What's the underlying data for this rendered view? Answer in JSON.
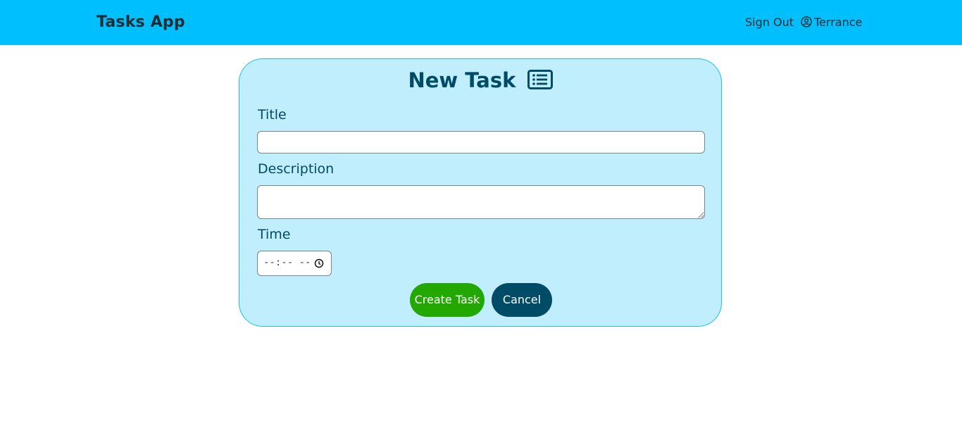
{
  "navbar": {
    "brand": "Tasks App",
    "signout_label": "Sign Out",
    "user_name": "Terrance",
    "user_icon": "user-circle-icon",
    "background": "#00bfff"
  },
  "form": {
    "title": "New Task",
    "title_icon": "list-icon",
    "fields": {
      "title_label": "Title",
      "title_value": "",
      "description_label": "Description",
      "description_value": "",
      "time_label": "Time",
      "time_placeholder": "--:-- --",
      "time_icon": "clock-icon"
    },
    "buttons": {
      "create_label": "Create Task",
      "cancel_label": "Cancel"
    },
    "colors": {
      "card_background": "#c0eefc",
      "text": "#004b66",
      "create_button": "#22a800",
      "cancel_button": "#004b66"
    }
  }
}
